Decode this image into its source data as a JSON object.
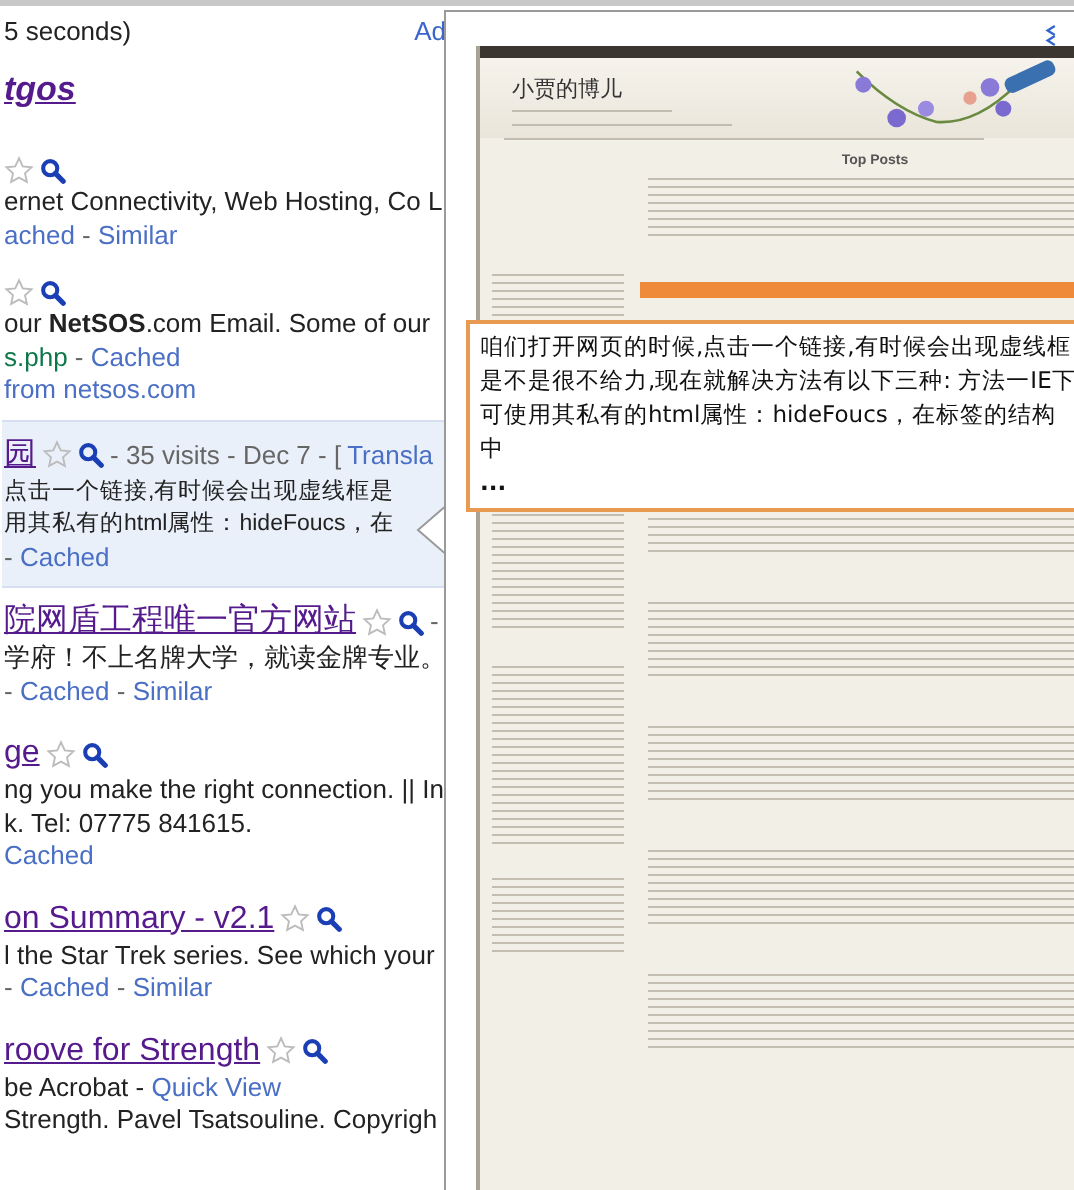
{
  "stats": "5 seconds)",
  "ads_label": "Ad",
  "results": [
    {
      "highlighted": false,
      "lines": [
        {
          "kind": "heading",
          "text": "tgos"
        }
      ]
    },
    {
      "highlighted": false,
      "lines": [
        {
          "kind": "icons",
          "starred": false
        },
        {
          "kind": "text",
          "text": "ernet Connectivity, Web Hosting, Co L"
        },
        {
          "kind": "links",
          "segments": [
            {
              "text": "ached",
              "kind": "link"
            },
            {
              "text": " - ",
              "kind": "sep"
            },
            {
              "text": "Similar",
              "kind": "link"
            }
          ]
        }
      ]
    },
    {
      "highlighted": false,
      "lines": [
        {
          "kind": "icons",
          "starred": false
        },
        {
          "kind": "text",
          "text": "our **NetSOS**.com Email. Some of our"
        },
        {
          "kind": "links",
          "segments": [
            {
              "text": "s.php",
              "kind": "url"
            },
            {
              "text": " - ",
              "kind": "sep"
            },
            {
              "text": "Cached",
              "kind": "link"
            }
          ]
        },
        {
          "kind": "links",
          "segments": [
            {
              "text": "from netsos.com",
              "kind": "link"
            }
          ]
        }
      ]
    },
    {
      "highlighted": true,
      "lines": [
        {
          "kind": "title",
          "text": "园",
          "starred": false,
          "after": [
            {
              "text": " - 35 visits - Dec 7 - [ ",
              "kind": "sep"
            },
            {
              "text": "Transla",
              "kind": "link"
            }
          ]
        },
        {
          "kind": "text",
          "text": "点击一个链接,有时候会出现虚线框是"
        },
        {
          "kind": "text",
          "text": "用其私有的html属性：hideFoucs，在"
        },
        {
          "kind": "links",
          "segments": [
            {
              "text": "- ",
              "kind": "sep"
            },
            {
              "text": "Cached",
              "kind": "link"
            }
          ]
        }
      ]
    },
    {
      "highlighted": false,
      "lines": [
        {
          "kind": "title",
          "text": "院网盾工程唯一官方网站",
          "starred": false,
          "after": [
            {
              "text": " -",
              "kind": "sep"
            }
          ]
        },
        {
          "kind": "text",
          "text": "学府！不上名牌大学，就读金牌专业。"
        },
        {
          "kind": "links",
          "segments": [
            {
              "text": "- ",
              "kind": "sep"
            },
            {
              "text": "Cached",
              "kind": "link"
            },
            {
              "text": " - ",
              "kind": "sep"
            },
            {
              "text": "Similar",
              "kind": "link"
            }
          ]
        }
      ]
    },
    {
      "highlighted": false,
      "lines": [
        {
          "kind": "title",
          "text": "ge",
          "starred": false
        },
        {
          "kind": "text",
          "text": "ng you make the right connection. || In"
        },
        {
          "kind": "text",
          "text": "k. Tel: 07775 841615."
        },
        {
          "kind": "links",
          "segments": [
            {
              "text": "Cached",
              "kind": "link"
            }
          ]
        }
      ]
    },
    {
      "highlighted": false,
      "lines": [
        {
          "kind": "title",
          "text": "on Summary - v2.1",
          "starred": false
        },
        {
          "kind": "text",
          "text": "l the Star Trek series. See which your"
        },
        {
          "kind": "links",
          "segments": [
            {
              "text": "- ",
              "kind": "sep"
            },
            {
              "text": "Cached",
              "kind": "link"
            },
            {
              "text": " - ",
              "kind": "sep"
            },
            {
              "text": "Similar",
              "kind": "link"
            }
          ]
        }
      ]
    },
    {
      "highlighted": false,
      "lines": [
        {
          "kind": "title",
          "text": "roove for Strength",
          "starred": false
        },
        {
          "kind": "links",
          "segments": [
            {
              "text": "be Acrobat - ",
              "kind": "plain"
            },
            {
              "text": "Quick View",
              "kind": "link"
            }
          ]
        },
        {
          "kind": "text",
          "text": "Strength. Pavel Tsatsouline. Copyrigh"
        }
      ]
    }
  ],
  "preview": {
    "site_title": "小贾的博儿",
    "top_posts_heading": "Top Posts",
    "callout": {
      "text": "咱们打开网页的时候,点击一个链接,有时候会出现虚线框是不是很不给力,现在就解决方法有以下三种: 方法一IE下可使用其私有的html属性：hideFoucs，在标签的结构中",
      "more": "..."
    }
  }
}
